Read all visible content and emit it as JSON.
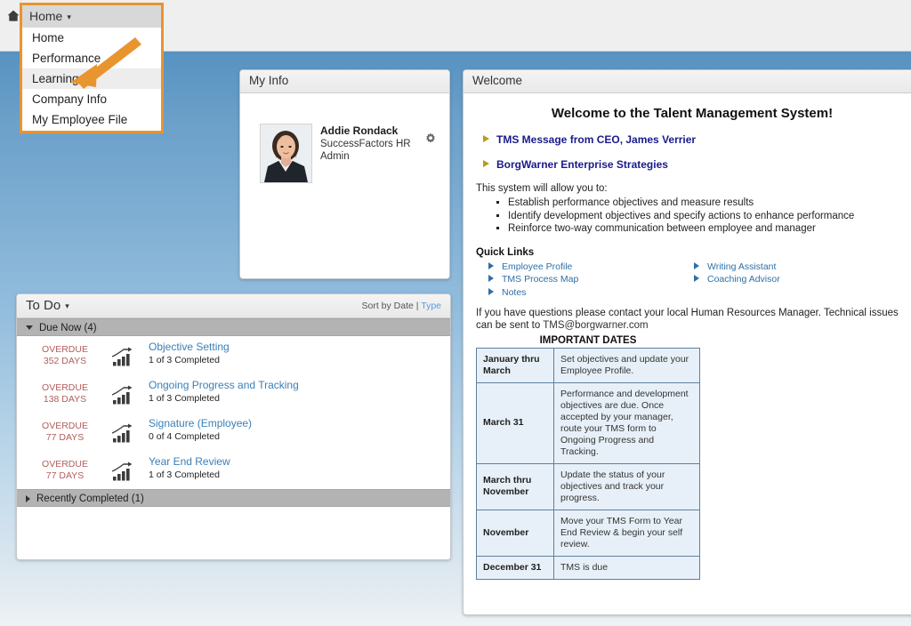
{
  "topbar": {
    "home_icon": "home-icon",
    "nav_tab_label": "Home",
    "caret": "▾",
    "breadcrumb": "Ho"
  },
  "dropdown": {
    "header_label": "Home",
    "caret": "▾",
    "items": [
      {
        "label": "Home",
        "selected": false
      },
      {
        "label": "Performance",
        "selected": false
      },
      {
        "label": "Learning",
        "selected": true
      },
      {
        "label": "Company Info",
        "selected": false
      },
      {
        "label": "My Employee File",
        "selected": false
      }
    ],
    "highlight_color": "#e8942f",
    "arrow_color": "#e8942f"
  },
  "my_info": {
    "title": "My Info",
    "avatar_alt": "employee-photo",
    "name": "Addie Rondack",
    "role": "SuccessFactors HR Admin",
    "gear_icon": "⚙"
  },
  "welcome": {
    "title": "Welcome",
    "heading": "Welcome to the Talent Management System!",
    "links": [
      "TMS Message from CEO, James Verrier",
      "BorgWarner Enterprise Strategies"
    ],
    "lead": "This system will allow you to:",
    "bullets": [
      "Establish performance objectives and measure results",
      "Identify development objectives and specify actions to enhance performance",
      "Reinforce two-way communication between employee and manager"
    ],
    "quick_links_title": "Quick Links",
    "quick_links_left": [
      "Employee Profile",
      "TMS Process Map",
      "Notes"
    ],
    "quick_links_right": [
      "Writing Assistant",
      "Coaching Advisor"
    ],
    "contact_text": "If you have questions please contact your local Human Resources Manager. Technical issues can be sent to ",
    "contact_email": "TMS@borgwarner.com",
    "dates_title": "IMPORTANT DATES",
    "dates_rows": [
      {
        "term": "January thru March",
        "desc": "Set objectives and update your Employee Profile."
      },
      {
        "term": "March 31",
        "desc": "Performance and development objectives are due. Once accepted by your manager, route your TMS form to Ongoing Progress and Tracking."
      },
      {
        "term": "March thru November",
        "desc": "Update the status of your objectives and track your progress."
      },
      {
        "term": "November",
        "desc": "Move your TMS Form to Year End Review & begin your self review."
      },
      {
        "term": "December 31",
        "desc": "TMS is due"
      }
    ]
  },
  "todo": {
    "title": "To Do",
    "caret": "▾",
    "sort_label": "Sort by Date |",
    "sort_type": "Type",
    "section_due": "Due Now (4)",
    "section_recent": "Recently Completed (1)",
    "items": [
      {
        "status": "OVERDUE",
        "days": "352 DAYS",
        "name": "Objective Setting",
        "progress": "1 of 3 Completed",
        "icon": "bar-chart-icon"
      },
      {
        "status": "OVERDUE",
        "days": "138 DAYS",
        "name": "Ongoing Progress and Tracking",
        "progress": "1 of 3 Completed",
        "icon": "bar-chart-icon"
      },
      {
        "status": "OVERDUE",
        "days": "77 DAYS",
        "name": "Signature (Employee)",
        "progress": "0 of 4 Completed",
        "icon": "bar-chart-icon"
      },
      {
        "status": "OVERDUE",
        "days": "77 DAYS",
        "name": "Year End Review",
        "progress": "1 of 3 Completed",
        "icon": "bar-chart-icon"
      }
    ]
  },
  "colors": {
    "accent_orange": "#e8942f",
    "link_blue": "#3a7fb8",
    "overdue_red": "#b35c5c",
    "nav_link_navy": "#1a1a8c",
    "desktop_blue": "#5792c1"
  }
}
